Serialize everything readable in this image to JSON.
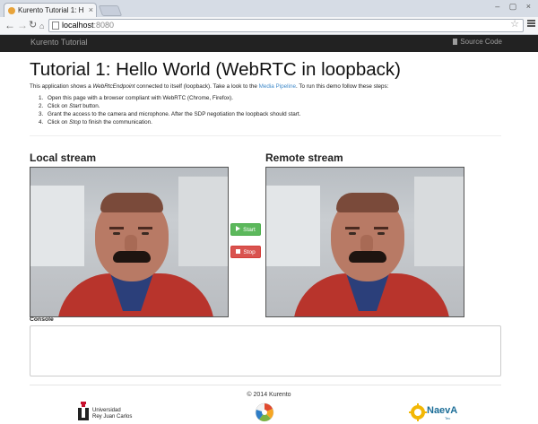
{
  "browser": {
    "tab_title": "Kurento Tutorial 1: H",
    "tab_close": "×",
    "window_controls": "– ▢ ×",
    "back_icon": "back-arrow-icon",
    "forward_icon": "forward-arrow-icon",
    "reload_icon": "reload-icon",
    "home_icon": "home-icon",
    "address_host": "localhost",
    "address_port": ":8080",
    "bookmark_icon": "star-icon"
  },
  "navbar": {
    "brand": "Kurento Tutorial",
    "source_link": "Source Code",
    "bg_color": "#222222"
  },
  "main": {
    "title": "Tutorial 1: Hello World (WebRTC in loopback)",
    "intro": {
      "part1": "This application shows a ",
      "endpoint": "WebRtcEndpoint",
      "part2": " connected to itself (loopback). Take a look to the ",
      "pipeline_link": "Media Pipeline",
      "part3": ". To run this demo follow these steps:"
    },
    "steps": [
      {
        "num": "1.",
        "text": "Open this page with a browser compliant with WebRTC (Chrome, Firefox)."
      },
      {
        "num": "2.",
        "pre": "Click on ",
        "em": "Start",
        "post": " button."
      },
      {
        "num": "3.",
        "text": "Grant the access to the camera and microphone. After the SDP negotiation the loopback should start."
      },
      {
        "num": "4.",
        "pre": "Click on ",
        "em": "Stop",
        "post": " to finish the communication."
      }
    ],
    "local_stream_title": "Local stream",
    "remote_stream_title": "Remote stream",
    "start_button": "Start",
    "stop_button": "Stop",
    "start_color": "#5cb85c",
    "stop_color": "#d9534f",
    "console_label": "Console"
  },
  "footer": {
    "copyright": "© 2014 Kurento",
    "urjc_line1": "Universidad",
    "urjc_line2": "Rey Juan Carlos",
    "naeva_text": "NaevA",
    "naeva_sub": "Tec"
  }
}
